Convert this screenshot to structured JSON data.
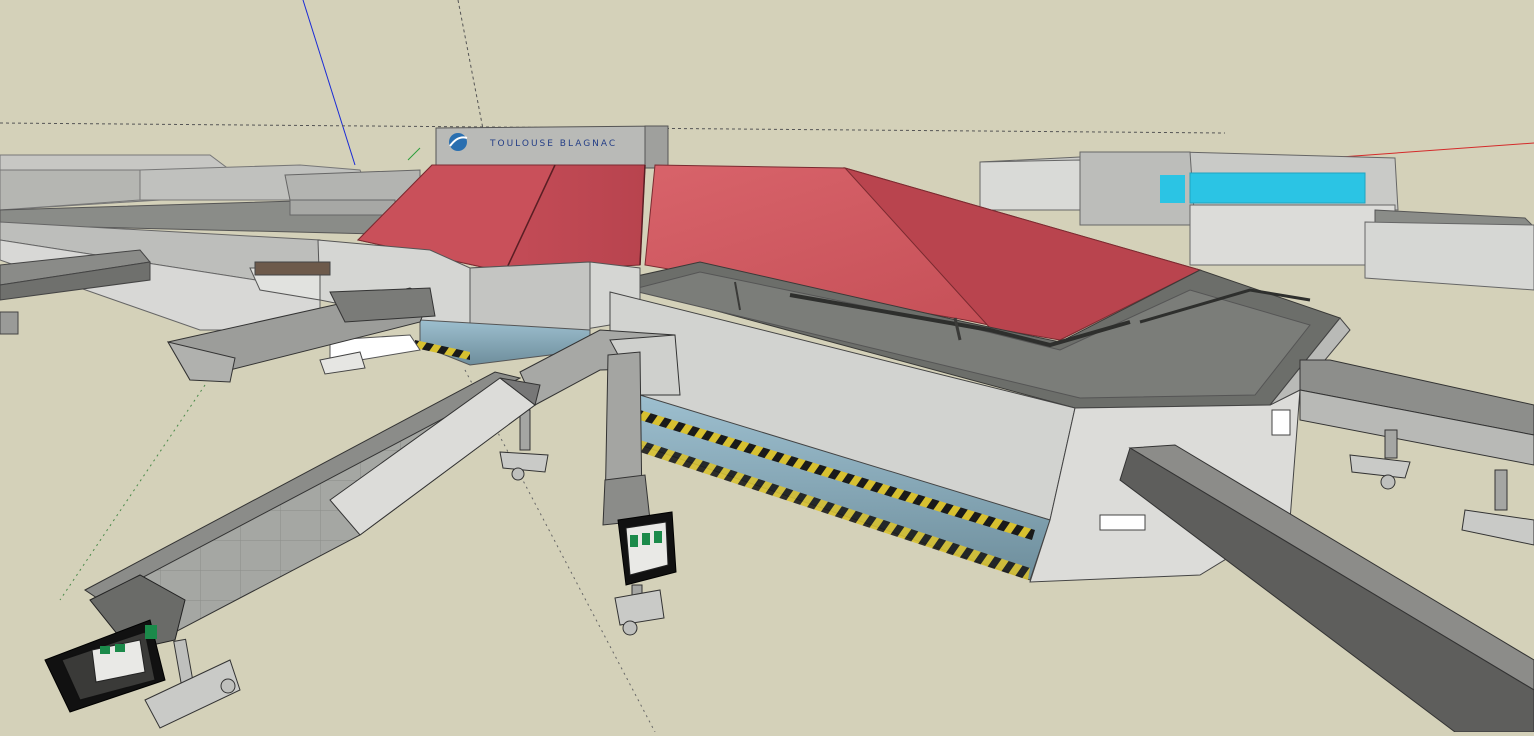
{
  "app": {
    "viewport_label": "3D model viewport"
  },
  "signage": {
    "text": "TOULOUSE  BLAGNAC",
    "logo_icon": "airport-logo-icon"
  },
  "scene": {
    "background_color": "#d4d1b9",
    "roof_color": "#c9505a",
    "glass_color": "#8fb5c8",
    "accent_cyan": "#2bc4e4",
    "axis_colors": {
      "blue": "#1a2bd6",
      "red": "#d42a2a",
      "green": "#2a9d3a"
    }
  }
}
